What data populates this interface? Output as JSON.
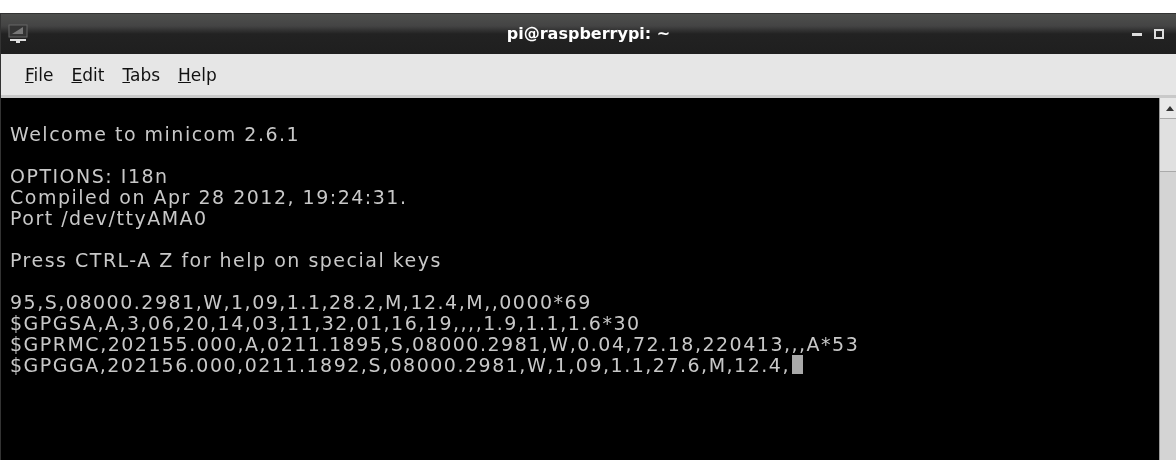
{
  "window": {
    "title": "pi@raspberrypi: ~"
  },
  "menu": [
    {
      "underlined": "F",
      "rest": "ile"
    },
    {
      "underlined": "E",
      "rest": "dit"
    },
    {
      "underlined": "T",
      "rest": "abs"
    },
    {
      "underlined": "H",
      "rest": "elp"
    }
  ],
  "terminal": {
    "blocks": [
      [
        "Welcome to minicom 2.6.1"
      ],
      [
        "OPTIONS: I18n",
        "Compiled on Apr 28 2012, 19:24:31.",
        "Port /dev/ttyAMA0"
      ],
      [
        "Press CTRL-A Z for help on special keys"
      ],
      [
        "95,S,08000.2981,W,1,09,1.1,28.2,M,12.4,M,,0000*69",
        "$GPGSA,A,3,06,20,14,03,11,32,01,16,19,,,,1.9,1.1,1.6*30",
        "$GPRMC,202155.000,A,0211.1895,S,08000.2981,W,0.04,72.18,220413,,,A*53",
        "$GPGGA,202156.000,0211.1892,S,08000.2981,W,1,09,1.1,27.6,M,12.4,"
      ]
    ]
  }
}
